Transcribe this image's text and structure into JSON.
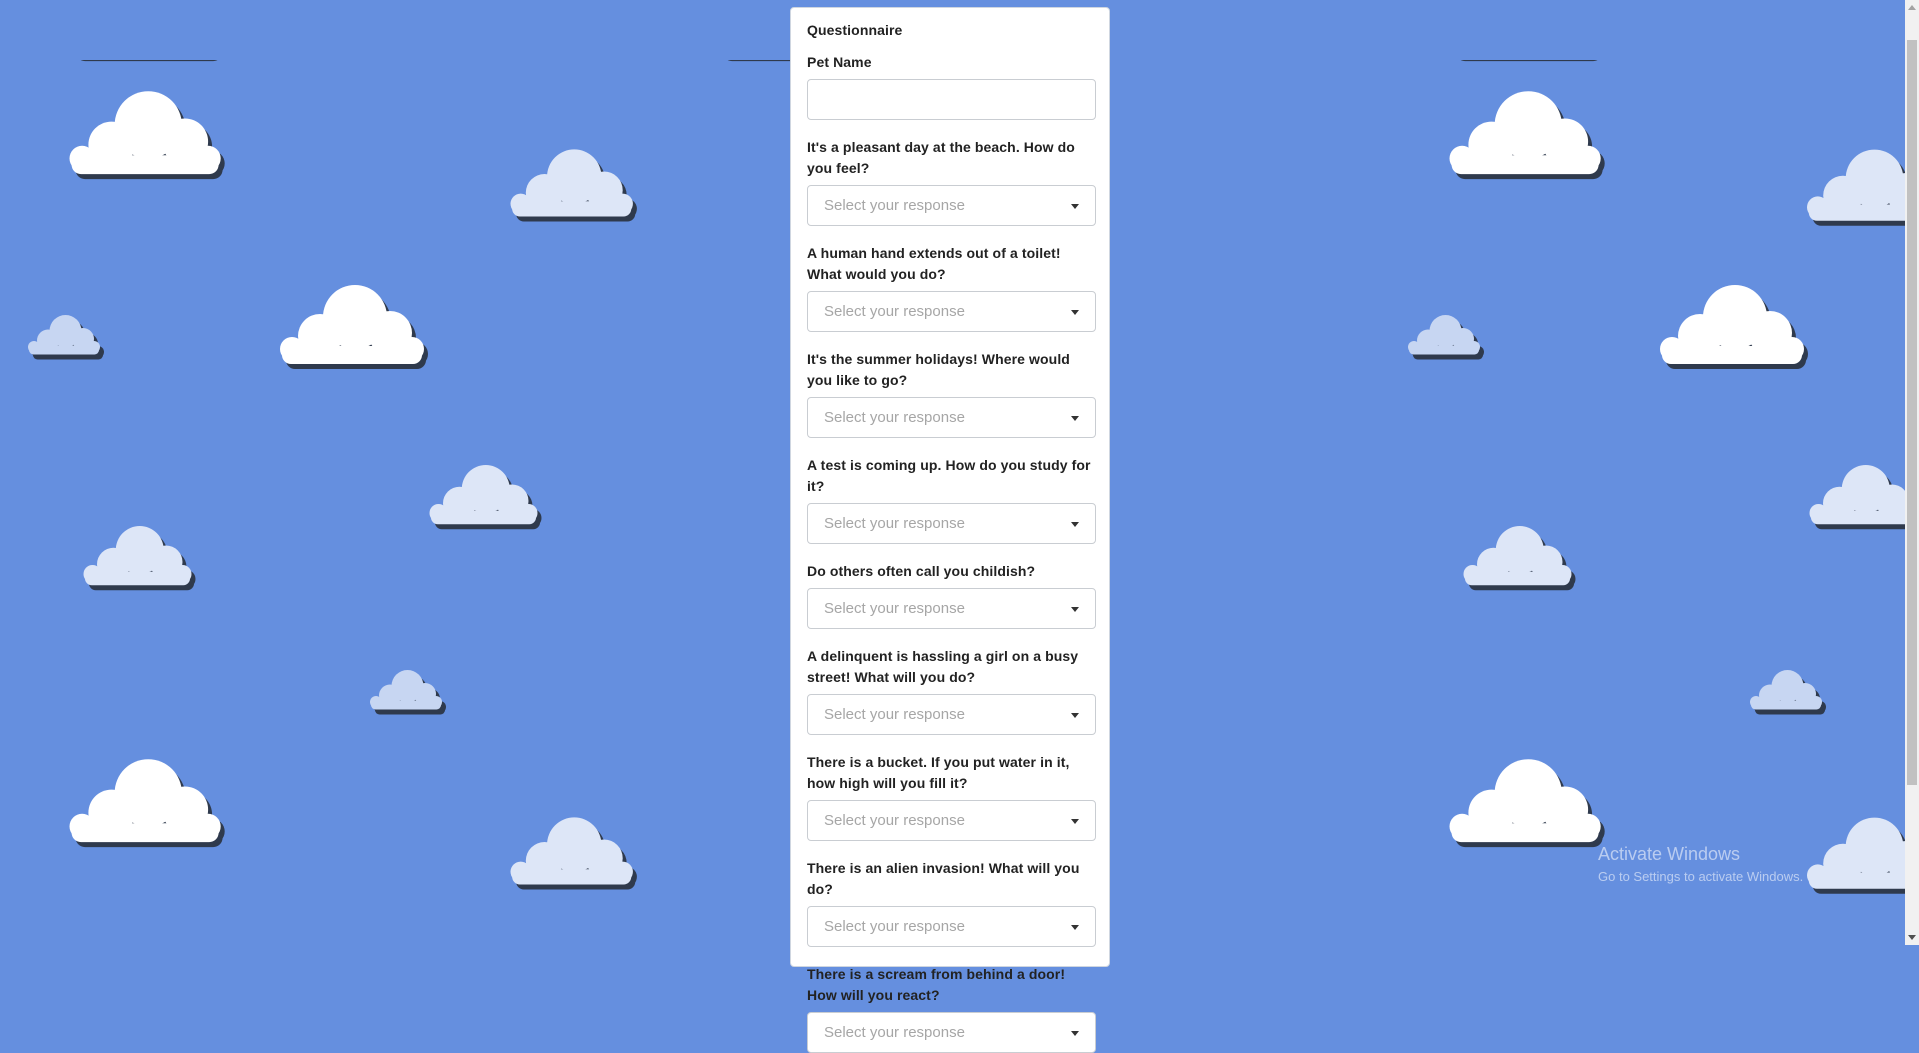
{
  "form": {
    "title": "Questionnaire",
    "pet_name": {
      "label": "Pet Name",
      "value": "",
      "placeholder": ""
    },
    "questions": [
      {
        "label": "It's a pleasant day at the beach. How do you feel?",
        "placeholder": "Select your response"
      },
      {
        "label": "A human hand extends out of a toilet! What would you do?",
        "placeholder": "Select your response"
      },
      {
        "label": "It's the summer holidays! Where would you like to go?",
        "placeholder": "Select your response"
      },
      {
        "label": "A test is coming up. How do you study for it?",
        "placeholder": "Select your response"
      },
      {
        "label": "Do others often call you childish?",
        "placeholder": "Select your response"
      },
      {
        "label": "A delinquent is hassling a girl on a busy street! What will you do?",
        "placeholder": "Select your response"
      },
      {
        "label": "There is a bucket. If you put water in it, how high will you fill it?",
        "placeholder": "Select your response"
      },
      {
        "label": "There is an alien invasion! What will you do?",
        "placeholder": "Select your response"
      },
      {
        "label": "There is a scream from behind a door! How will you react?",
        "placeholder": "Select your response"
      }
    ]
  },
  "watermark": {
    "title": "Activate Windows",
    "subtitle": "Go to Settings to activate Windows."
  },
  "colors": {
    "background": "#658fdf",
    "cloud_white": "#ffffff",
    "cloud_light": "#dde6f7",
    "cloud_blue": "#c7d6f2",
    "cloud_shadow": "#2f3a4d"
  }
}
